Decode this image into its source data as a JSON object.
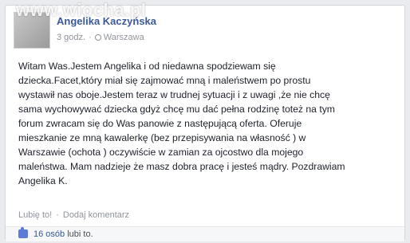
{
  "watermark": "www.wiocha.pl",
  "post": {
    "author": "Angelika Kaczyńska",
    "time": "3 godz.",
    "separator": "·",
    "location": "Warszawa",
    "text": "Witam Was.Jestem Angelika i od niedawna spodziewam się\ndziecka.Facet,który miał się zajmować mną i maleństwem po prostu\nwystawił nas oboje.Jestem teraz w trudnej sytuacji i z uwagi ,że nie chcę\nsama wychowywać dziecka gdyż chcę mu dać pełna rodzinę toteż na tym\nforum zwracam się do Was panowie z następującą oferta. Oferuje\nmieszkanie ze mną kawalerkę (bez przepisywania na własność ) w\nWarszawie (ochota ) oczywiście w zamian za ojcostwo dla mojego\nmaleństwa. Mam nadzieje że masz dobra pracę i jesteś mądry. Pozdrawiam\nAngelika K."
  },
  "actions": {
    "like": "Lubię to!",
    "separator": "·",
    "comment": "Dodaj komentarz"
  },
  "likes": {
    "count": "16 osób",
    "suffix": " lubi to."
  },
  "colors": {
    "link": "#3b5998",
    "meta": "#90949c",
    "text": "#1d2129",
    "background": "#e9ebee"
  }
}
